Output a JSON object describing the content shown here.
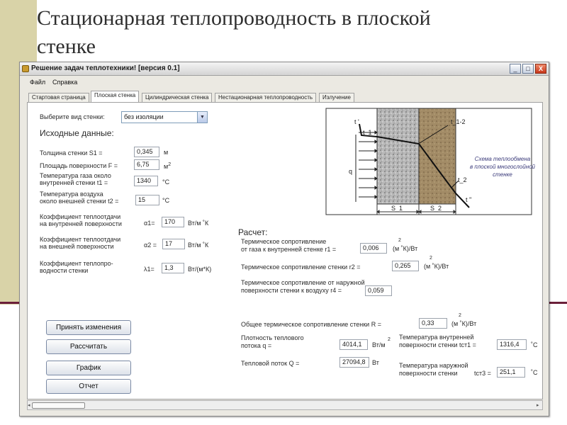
{
  "slide": {
    "title": "Стационарная теплопроводность в плоской стенке"
  },
  "window": {
    "title": "Решение задач теплотехники! [версия 0.1]",
    "icon": "app-icon",
    "controls": {
      "minimize": "_",
      "maximize": "□",
      "close": "X"
    }
  },
  "menu": {
    "items": [
      "Файл",
      "Справка"
    ]
  },
  "tabs": [
    "Стартовая страница",
    "Плоская стенка",
    "Цилиндрическая стенка",
    "Нестационарная теплопроводность",
    "Излучение"
  ],
  "active_tab": "Плоская стенка",
  "wall_type": {
    "label": "Выберите вид стенки:",
    "value": "без изоляции"
  },
  "source_header": "Исходные данные:",
  "inputs": {
    "thickness": {
      "label": "Толщина стенки S1 =",
      "value": "0,345",
      "unit": "м"
    },
    "area": {
      "label": "Площадь поверхности F =",
      "value": "6,75",
      "unit": "м",
      "unit_sup": "2"
    },
    "gas_temp": {
      "label1": "Температура газа около",
      "label2": "внутренней стенки t1 =",
      "value": "1340",
      "unit": "°С"
    },
    "air_temp": {
      "label1": "Температура воздуха",
      "label2": "около внешней стенки t2 =",
      "value": "15",
      "unit": "°С"
    },
    "alpha1": {
      "label1": "Коэффициент теплоотдачи",
      "label2": "на внутренней поверхности",
      "sym": "α1=",
      "value": "170",
      "unit": "Вт/м ˚К"
    },
    "alpha2": {
      "label1": "Коэффициент теплоотдачи",
      "label2": "на внешней поверхности",
      "sym": "α2 =",
      "value": "17",
      "unit": "Вт/м ˚К"
    },
    "lambda1": {
      "label1": "Коэффициент теплопро-",
      "label2": "водности стенки",
      "sym": "λ1=",
      "value": "1,3",
      "unit": "Вт/(м*К)"
    }
  },
  "diagram": {
    "labels": {
      "t_top": "t '",
      "t1": "t_1",
      "t12": "t_1-2",
      "t2": "t_2",
      "t_bottom": "t ''",
      "q": "q",
      "s1": "S_1",
      "s2": "S_2"
    },
    "caption": [
      "Схема теплообмена",
      "в плоской многослойной",
      "стенке"
    ]
  },
  "calc": {
    "header": "Расчет:",
    "r1": {
      "label1": "Термическое сопротивление",
      "label2": "от газа к внутренней стенке r1 =",
      "value": "0,006",
      "unit": "(м ˚К)/Вт",
      "sup": "2"
    },
    "r2": {
      "label": "Термическое сопротивление стенки r2 =",
      "value": "0,265",
      "unit": "(м ˚К)/Вт",
      "sup": "2"
    },
    "r4": {
      "label1": "Термическое сопротивление от наружной",
      "label2": "поверхности стенки к воздуху r4 =",
      "value": "0,059"
    },
    "total_r": {
      "label": "Общее термическое сопротивление стенки R =",
      "value": "0,33",
      "unit": "(м ˚К)/Вт",
      "sup": "2"
    },
    "q_density": {
      "label1": "Плотность теплового",
      "label2": "потока q =",
      "value": "4014,1",
      "unit": "Вт/м",
      "sup": "2"
    },
    "Q_flow": {
      "label": "Тепловой поток Q =",
      "value": "27094,8",
      "unit": "Вт"
    },
    "tct1": {
      "label1": "Температура внутренней",
      "label2": "поверхности стенки tст1 =",
      "value": "1316,4",
      "unit": "˚С"
    },
    "tct3": {
      "label1": "Температура наружной",
      "label2": "поверхности стенки",
      "sym": "tст3 =",
      "value": "251,1",
      "unit": "˚С"
    }
  },
  "buttons": {
    "apply": "Принять изменения",
    "calculate": "Рассчитать",
    "graph": "График",
    "report": "Отчет"
  }
}
